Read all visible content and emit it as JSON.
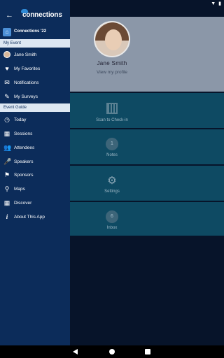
{
  "app": {
    "logo_text": "connections"
  },
  "event": {
    "name": "Connections '22"
  },
  "profile": {
    "name": "Jane Smith",
    "link": "View my profile"
  },
  "sections": {
    "my_event": "My Event",
    "event_guide": "Event Guide"
  },
  "my_event_items": [
    {
      "label": "Jane Smith",
      "icon": "avatar"
    },
    {
      "label": "My Favorites",
      "icon": "heart-icon"
    },
    {
      "label": "Notifications",
      "icon": "envelope-icon"
    },
    {
      "label": "My Surveys",
      "icon": "pencil-icon"
    }
  ],
  "guide_items": [
    {
      "label": "Today",
      "icon": "clock-icon"
    },
    {
      "label": "Sessions",
      "icon": "calendar-icon"
    },
    {
      "label": "Attendees",
      "icon": "people-icon"
    },
    {
      "label": "Speakers",
      "icon": "speaker-icon"
    },
    {
      "label": "Sponsors",
      "icon": "flag-icon"
    },
    {
      "label": "Maps",
      "icon": "map-pin-icon"
    },
    {
      "label": "Discover",
      "icon": "grid-icon"
    },
    {
      "label": "About This App",
      "icon": "info-icon"
    }
  ],
  "tiles": [
    {
      "label": "Scan to Check-in",
      "icon": "qr-code-icon"
    },
    {
      "label": "Notes",
      "icon": "notes-icon",
      "count": "1"
    },
    {
      "label": "Settings",
      "icon": "gear-icon"
    },
    {
      "label": "Inbox",
      "icon": "inbox-icon",
      "count": "6"
    }
  ],
  "colors": {
    "drawer_bg": "#0c2c5a",
    "section_bg": "#dde7f2",
    "accent": "#4b8fd6",
    "tile_bg": "#0e4a63"
  }
}
